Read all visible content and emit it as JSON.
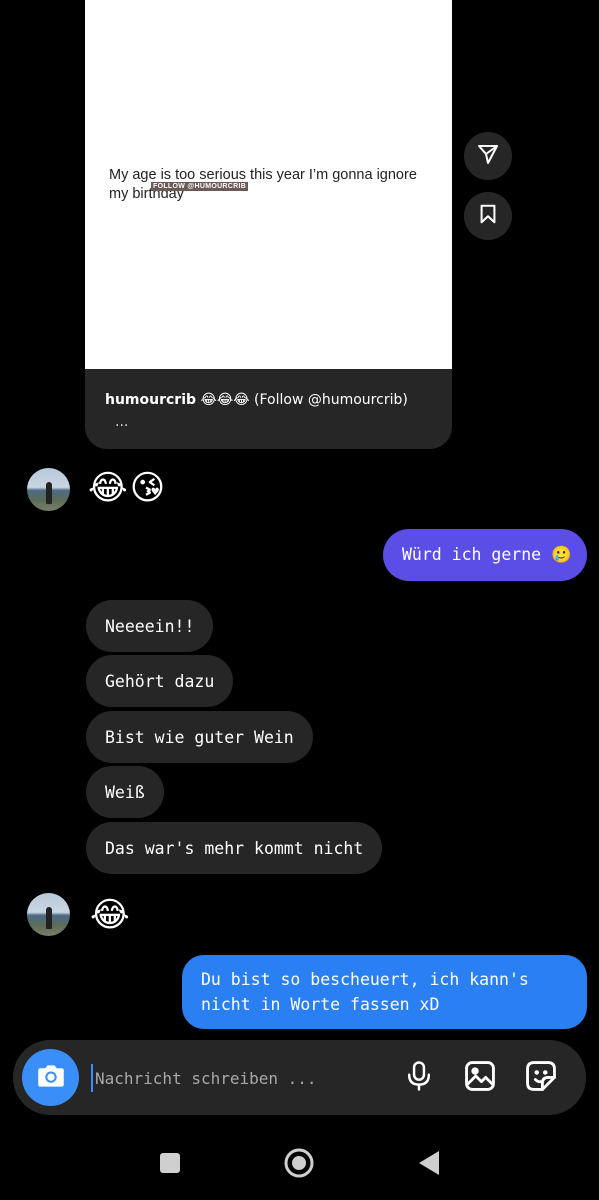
{
  "shared_post": {
    "image_text": "My age is too serious this year I’m gonna ignore my birthday",
    "watermark": "FOLLOW @HUMOURCRIB",
    "caption_author": "humourcrib",
    "caption_text": " 😂😂😂 (Follow @humourcrib)",
    "caption_more": "..."
  },
  "side_actions": {
    "share_icon": "send-icon",
    "save_icon": "bookmark-icon"
  },
  "messages": [
    {
      "side": "in",
      "kind": "emoji",
      "text": "😂😘"
    },
    {
      "side": "out",
      "text": "Würd ich gerne 🥲"
    },
    {
      "side": "in",
      "text": "Neeeein!!"
    },
    {
      "side": "in",
      "text": "Gehört dazu"
    },
    {
      "side": "in",
      "text": "Bist wie guter Wein"
    },
    {
      "side": "in",
      "text": "Weiß"
    },
    {
      "side": "in",
      "text": "Das war's mehr kommt nicht"
    },
    {
      "side": "in",
      "kind": "emoji",
      "text": "😂"
    },
    {
      "side": "out",
      "text": "Du bist so bescheuert, ich kann's nicht in Worte fassen xD"
    }
  ],
  "composer": {
    "placeholder": "Nachricht schreiben ...",
    "value": "",
    "icons": [
      "camera-icon",
      "microphone-icon",
      "gallery-icon",
      "sticker-icon"
    ]
  },
  "colors": {
    "background": "#000000",
    "incoming_bubble": "#262626",
    "outgoing_purple": "#5b4ee6",
    "outgoing_blue": "#2a7ff3",
    "camera_button": "#3a8ef7"
  }
}
